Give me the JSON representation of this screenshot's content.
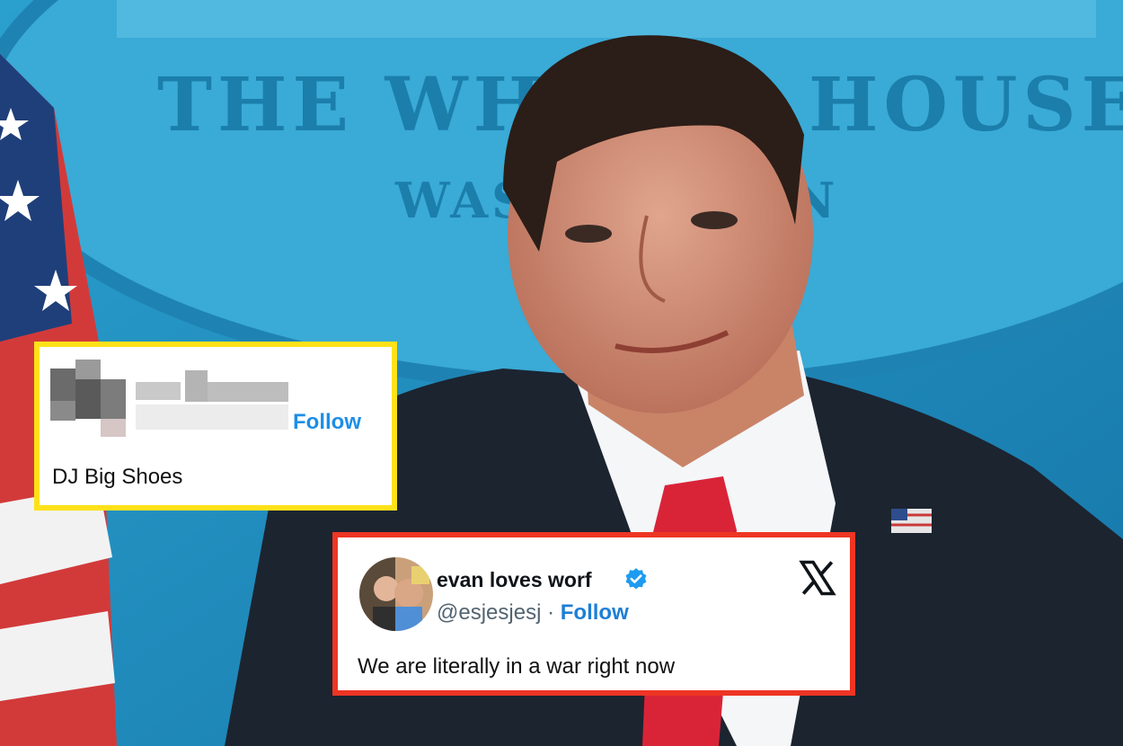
{
  "background": {
    "seal_text_line1": "THE WHITE HOUSE",
    "seal_text_line2": "WASHINGTON"
  },
  "tweets": [
    {
      "id": "yellow",
      "border_color": "#ffe11a",
      "name": "",
      "follow_label": "Follow",
      "text": "DJ Big Shoes",
      "author_blurred": true
    },
    {
      "id": "red",
      "border_color": "#ee3524",
      "name": "evan loves worf",
      "handle": "@esjesjesj",
      "separator": "·",
      "follow_label": "Follow",
      "text": "We are literally in a war right now",
      "verified": true,
      "platform_icon": "x-logo-icon"
    }
  ],
  "colors": {
    "accent_blue": "#1d8fe6",
    "verified_blue": "#1d9bf0",
    "stage_blue": "#1f8fbf"
  }
}
